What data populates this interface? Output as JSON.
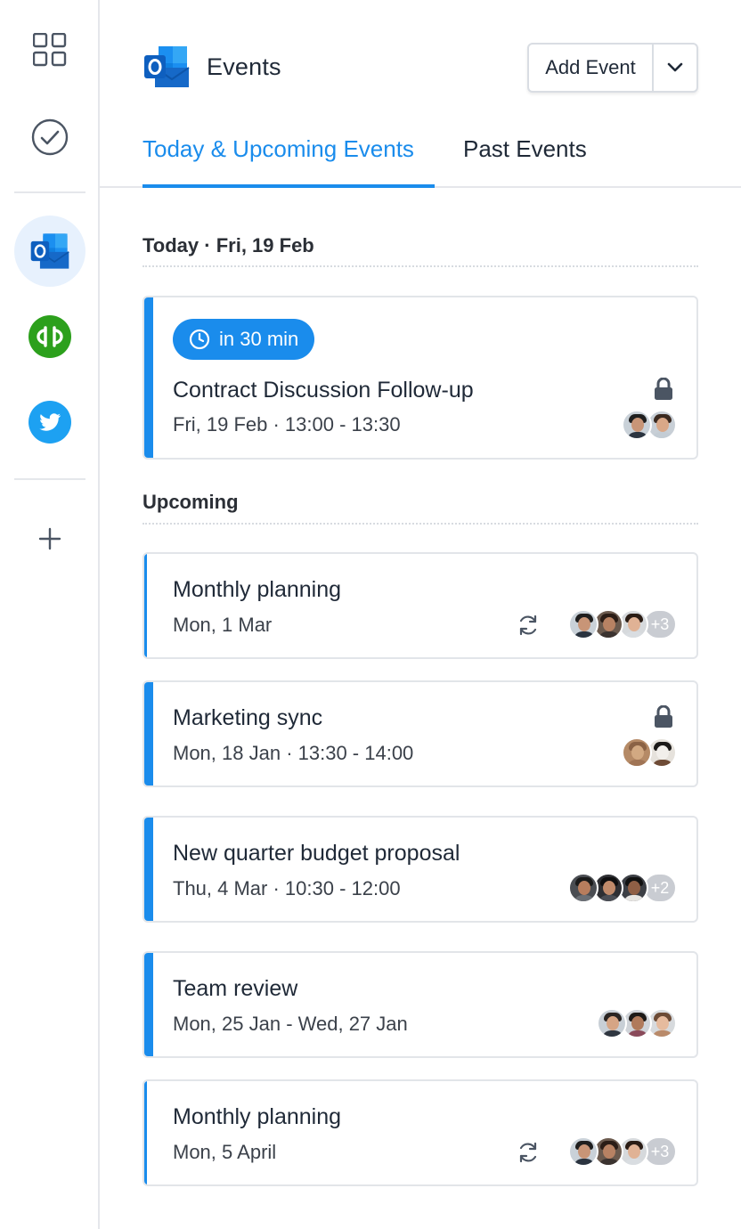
{
  "app": {
    "title": "Events"
  },
  "header": {
    "add_event_label": "Add Event"
  },
  "tabs": [
    {
      "label": "Today & Upcoming Events",
      "active": true
    },
    {
      "label": "Past Events",
      "active": false
    }
  ],
  "sidebar": {
    "items": [
      {
        "icon": "grid-icon"
      },
      {
        "icon": "check-circle-icon"
      },
      {
        "icon": "outlook-icon",
        "active": true
      },
      {
        "icon": "quickbooks-icon"
      },
      {
        "icon": "twitter-icon"
      },
      {
        "icon": "plus-icon"
      }
    ]
  },
  "today": {
    "heading": "Today · Fri, 19 Feb",
    "event": {
      "badge": "in 30 min",
      "title": "Contract Discussion Follow-up",
      "time": "Fri, 19 Feb · 13:00 - 13:30",
      "private": true
    }
  },
  "upcoming": {
    "heading": "Upcoming",
    "events": [
      {
        "title": "Monthly planning",
        "time": "Mon, 1 Mar",
        "recurring": true,
        "more": "+3"
      },
      {
        "title": "Marketing sync",
        "time": "Mon, 18 Jan · 13:30 - 14:00",
        "private": true
      },
      {
        "title": "New quarter budget proposal",
        "time": "Thu, 4 Mar · 10:30 - 12:00",
        "more": "+2"
      },
      {
        "title": "Team review",
        "time": "Mon, 25 Jan - Wed, 27 Jan"
      },
      {
        "title": "Monthly planning",
        "time": "Mon, 5 April",
        "recurring": true,
        "more": "+3"
      }
    ]
  },
  "colors": {
    "accent": "#1a8cec",
    "text": "#1f2937",
    "border": "#e2e5e9"
  }
}
